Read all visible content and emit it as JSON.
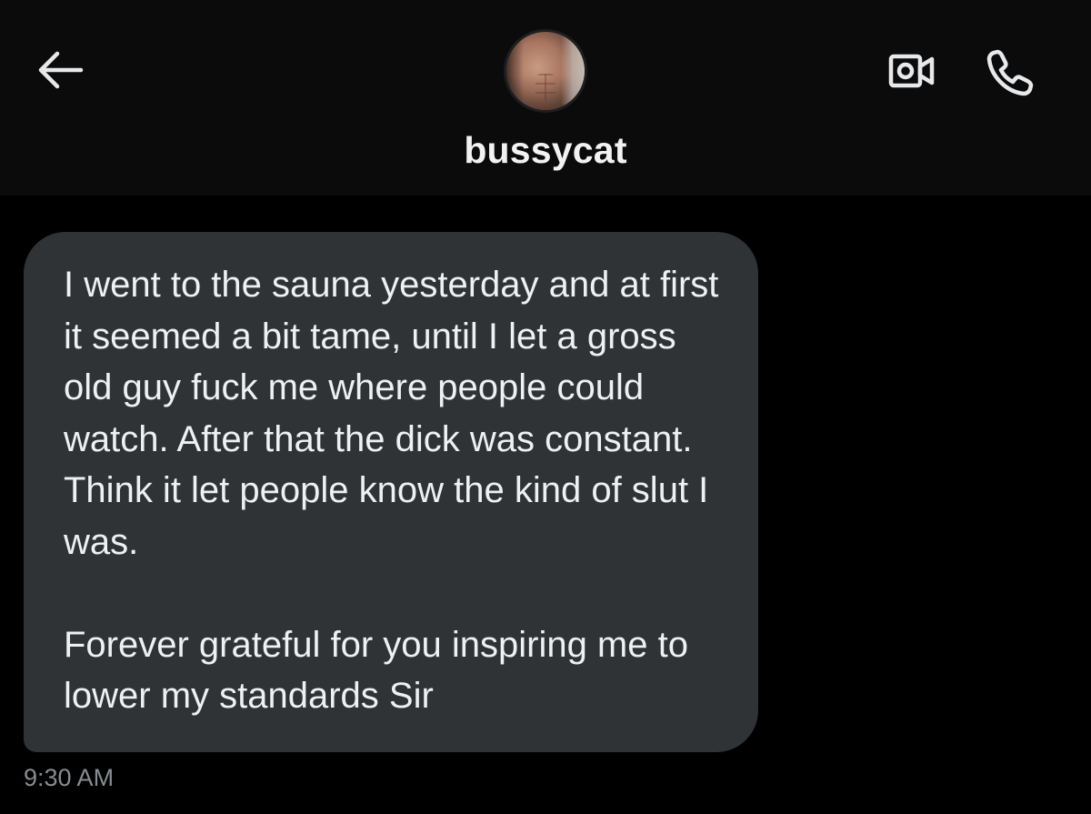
{
  "header": {
    "back_icon": "arrow-left-icon",
    "username": "bussycat",
    "video_icon": "video-camera-icon",
    "phone_icon": "phone-icon"
  },
  "message": {
    "paragraphs": [
      "I went to the sauna yesterday and at first it seemed a bit tame, until I let a gross old guy fuck me where people could watch. After that the dick was constant. Think it let people know the kind of slut I was.",
      "Forever grateful for you inspiring me to lower my standards Sir"
    ],
    "timestamp": "9:30 AM"
  },
  "colors": {
    "background": "#000000",
    "header_background": "#0b0b0c",
    "bubble_background": "#2f3336",
    "text": "#eef0f1",
    "timestamp": "#878c90"
  }
}
